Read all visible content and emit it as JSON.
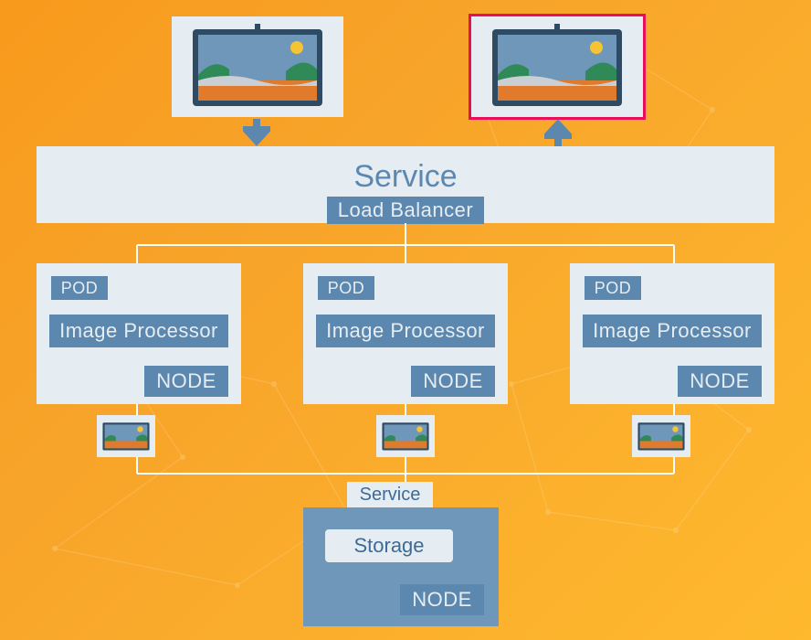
{
  "colors": {
    "accent": "#5c88b0",
    "panel": "#e6edf2",
    "highlight": "#e80e5a",
    "bgFrom": "#f89a1c",
    "bgTo": "#ffb92e"
  },
  "hero": {
    "left_alt": "input image",
    "right_alt": "output image"
  },
  "service": {
    "title": "Service",
    "load_balancer": "Load Balancer"
  },
  "pods": [
    {
      "tag": "POD",
      "processor": "Image Processor",
      "node": "NODE"
    },
    {
      "tag": "POD",
      "processor": "Image Processor",
      "node": "NODE"
    },
    {
      "tag": "POD",
      "processor": "Image Processor",
      "node": "NODE"
    }
  ],
  "bottom": {
    "service": "Service",
    "storage": "Storage",
    "node": "NODE"
  }
}
